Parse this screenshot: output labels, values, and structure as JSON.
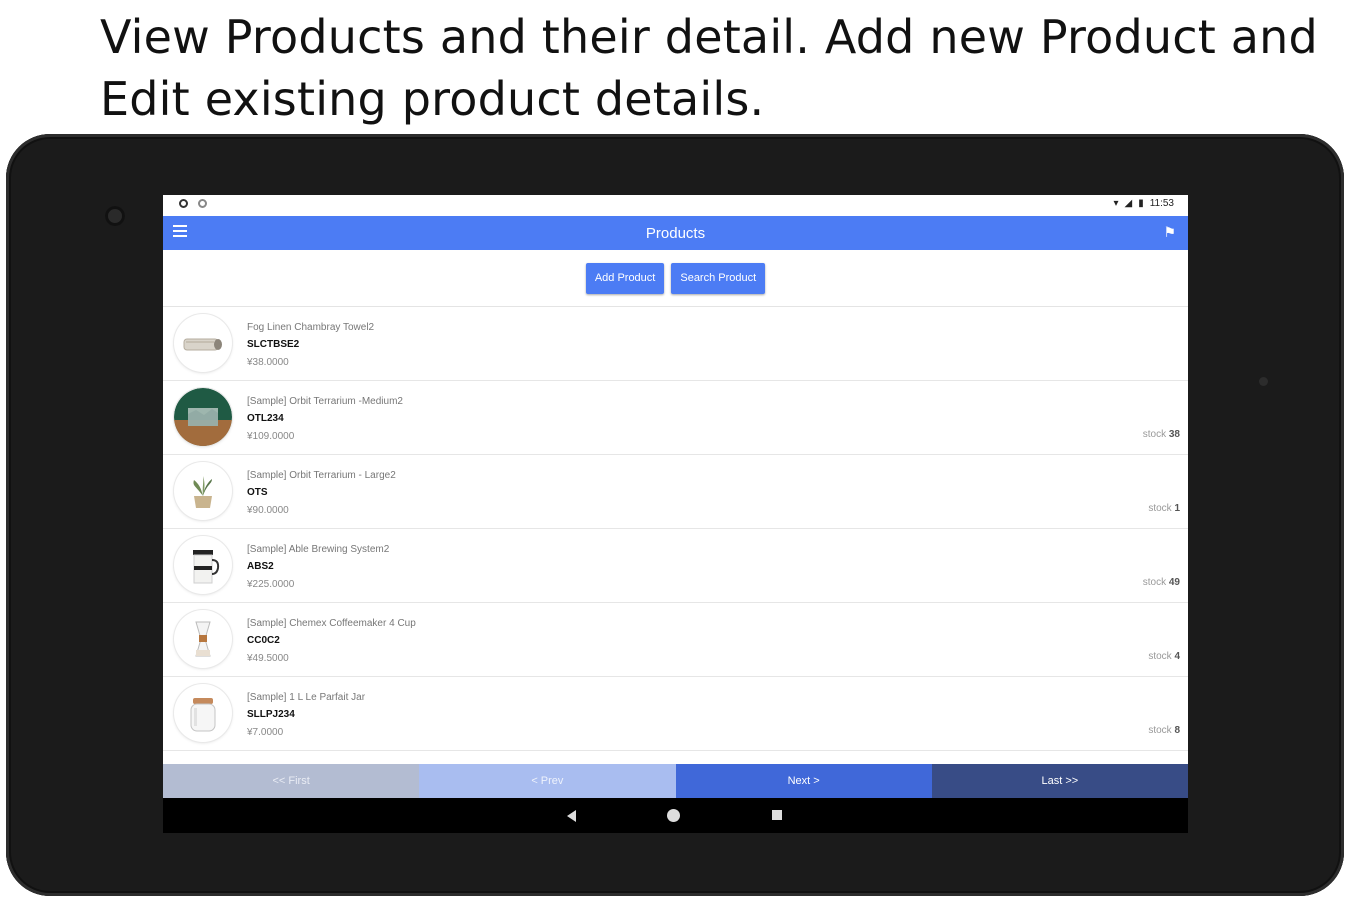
{
  "caption": "View Products and their detail. Add new Product and Edit existing product details.",
  "status_bar": {
    "time": "11:53"
  },
  "app_bar": {
    "title": "Products"
  },
  "toolbar": {
    "add_label": "Add Product",
    "search_label": "Search Product"
  },
  "products": [
    {
      "name": "Fog Linen Chambray Towel2",
      "sku": "SLCTBSE2",
      "price": "¥38.0000",
      "stock_label": "",
      "stock": "",
      "icon": "towel-image"
    },
    {
      "name": "[Sample] Orbit Terrarium -Medium2",
      "sku": "OTL234",
      "price": "¥109.0000",
      "stock_label": "stock",
      "stock": "38",
      "icon": "terrarium-image"
    },
    {
      "name": "[Sample] Orbit Terrarium - Large2",
      "sku": "OTS",
      "price": "¥90.0000",
      "stock_label": "stock",
      "stock": "1",
      "icon": "plant-image"
    },
    {
      "name": "[Sample] Able Brewing System2",
      "sku": "ABS2",
      "price": "¥225.0000",
      "stock_label": "stock",
      "stock": "49",
      "icon": "brewer-image"
    },
    {
      "name": "[Sample] Chemex Coffeemaker 4 Cup",
      "sku": "CC0C2",
      "price": "¥49.5000",
      "stock_label": "stock",
      "stock": "4",
      "icon": "coffeemaker-image"
    },
    {
      "name": "[Sample] 1 L Le Parfait Jar",
      "sku": "SLLPJ234",
      "price": "¥7.0000",
      "stock_label": "stock",
      "stock": "8",
      "icon": "jar-image"
    }
  ],
  "pager": {
    "first": "<< First",
    "prev": "< Prev",
    "next": "Next >",
    "last": "Last >>"
  },
  "colors": {
    "app_bar": "#4c7cf4",
    "pager_first": "#b3bcd2",
    "pager_prev": "#a9bdf0",
    "pager_next": "#4068d9",
    "pager_last": "#384c86"
  }
}
